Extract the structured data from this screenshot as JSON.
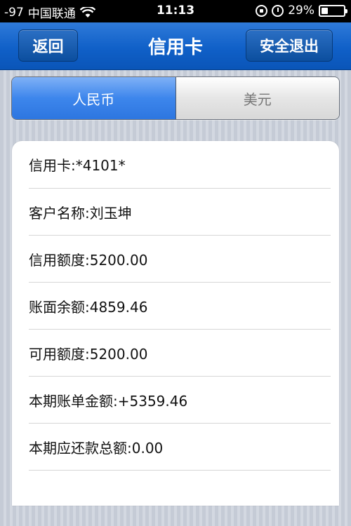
{
  "status_bar": {
    "signal": "-97",
    "carrier": "中国联通",
    "time": "11:13",
    "battery": "29%",
    "battery_level": 0.29,
    "icons": [
      "wifi-icon",
      "rotation-lock-icon",
      "alarm-icon",
      "battery-icon"
    ]
  },
  "nav": {
    "back_label": "返回",
    "title": "信用卡",
    "logout_label": "安全退出"
  },
  "currency_tabs": {
    "items": [
      "人民币",
      "美元"
    ],
    "selected": "人民币"
  },
  "details": [
    "信用卡:*4101*",
    "客户名称:刘玉坤",
    "信用额度:5200.00",
    "账面余额:4859.46",
    "可用额度:5200.00",
    "本期账单金额:+5359.46",
    "本期应还款总额:0.00"
  ],
  "colors": {
    "nav_blue": "#1060c8",
    "segment_active": "#3d86ec"
  }
}
